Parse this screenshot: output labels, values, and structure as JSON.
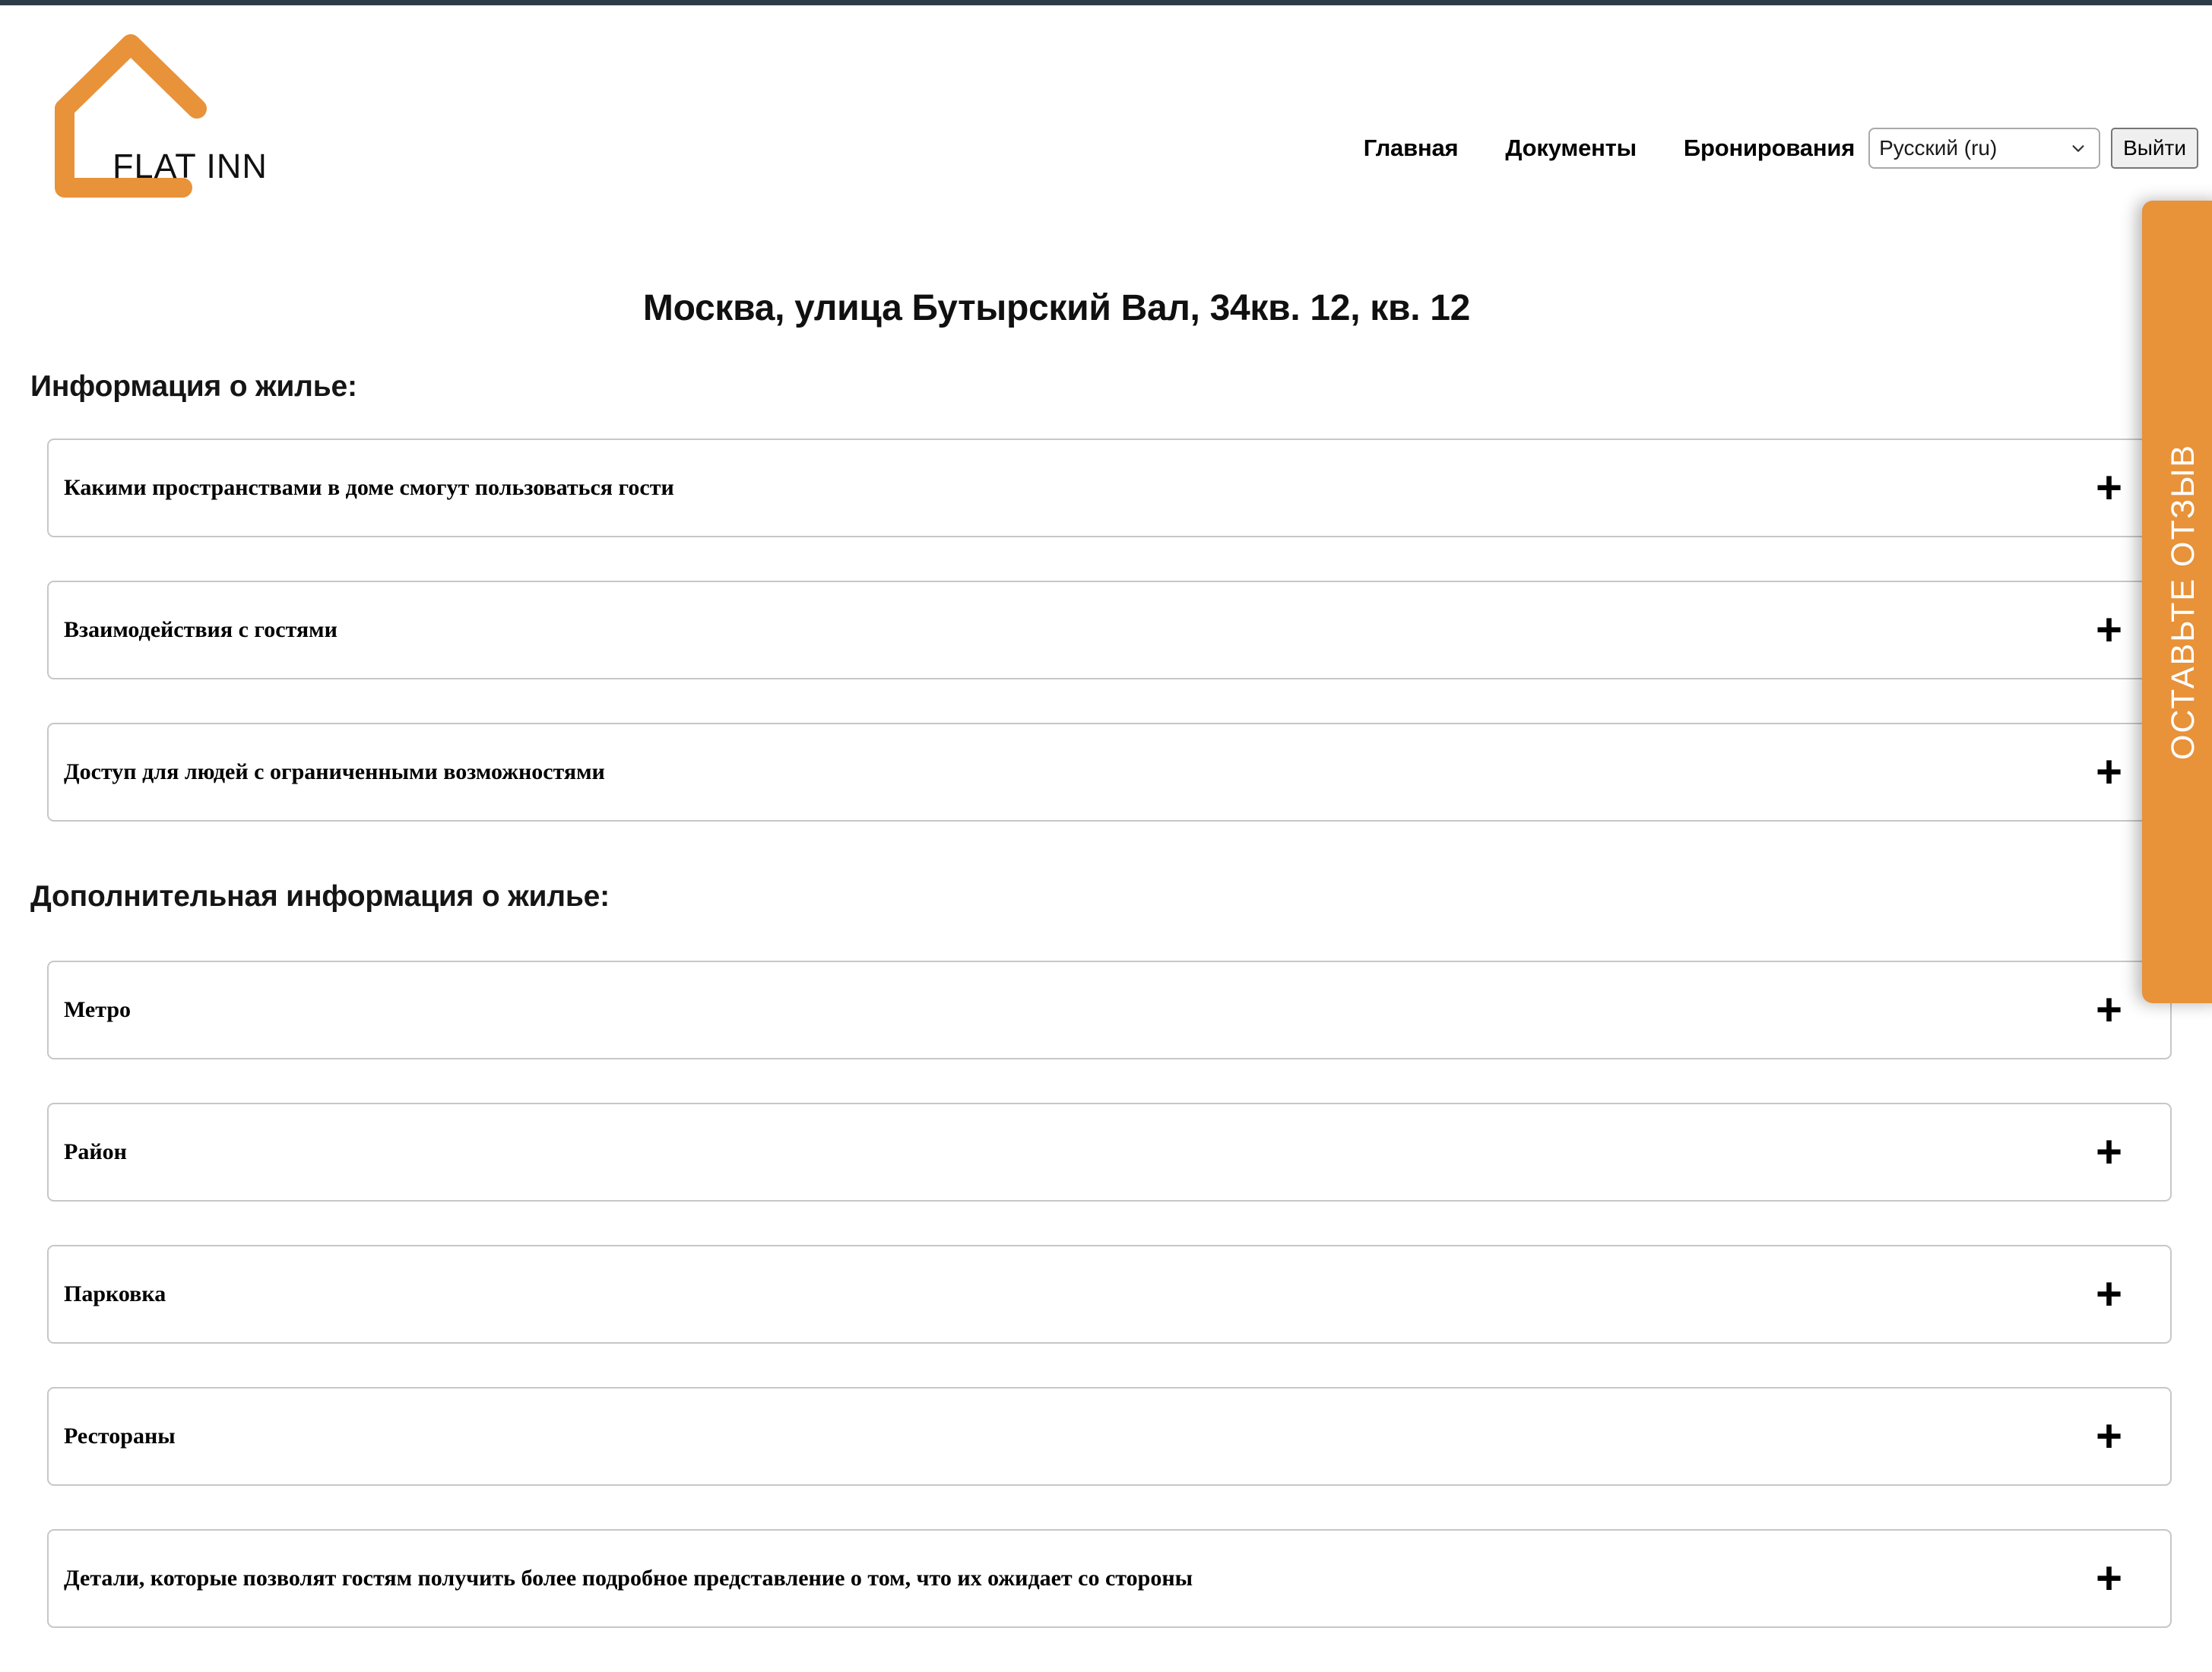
{
  "brand": {
    "name": "FLAT INN",
    "logo_color": "#E8923A"
  },
  "topbar": {
    "color": "#2D3C47"
  },
  "nav": {
    "links": [
      {
        "label": "Главная"
      },
      {
        "label": "Документы"
      },
      {
        "label": "Бронирования"
      }
    ],
    "language_select": {
      "selected": "Русский (ru)",
      "options": [
        "Русский (ru)"
      ]
    },
    "logout_label": "Выйти"
  },
  "page": {
    "title": "Москва, улица Бутырский Вал, 34кв. 12, кв. 12"
  },
  "sections": [
    {
      "heading": "Информация о жилье:",
      "items": [
        {
          "label": "Какими пространствами в доме смогут пользоваться гости",
          "toggle": "+"
        },
        {
          "label": "Взаимодействия с гостями",
          "toggle": "+"
        },
        {
          "label": "Доступ для людей с ограниченными возможностями",
          "toggle": "+"
        }
      ]
    },
    {
      "heading": "Дополнительная информация о жилье:",
      "items": [
        {
          "label": "Метро",
          "toggle": "+"
        },
        {
          "label": "Район",
          "toggle": "+"
        },
        {
          "label": "Парковка",
          "toggle": "+"
        },
        {
          "label": "Рестораны",
          "toggle": "+"
        },
        {
          "label": "Детали, которые позволят гостям получить более подробное представление о том, что их ожидает со стороны",
          "toggle": "+"
        }
      ]
    }
  ],
  "review_tab": {
    "label": "ОСТАВЬТЕ ОТЗЫВ",
    "color": "#E8923A"
  }
}
